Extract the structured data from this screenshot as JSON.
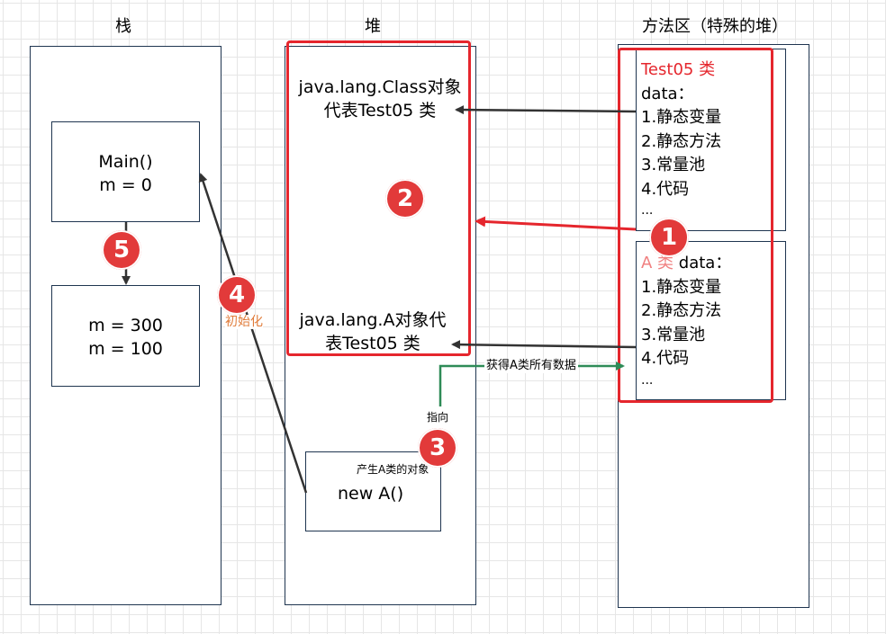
{
  "titles": {
    "stack": "栈",
    "heap": "堆",
    "method_area": "方法区（特殊的堆）"
  },
  "stack": {
    "main_frame": {
      "line1": "Main()",
      "line2": "m = 0"
    },
    "frame2": {
      "line1": "m = 300",
      "line2": "m = 100"
    }
  },
  "heap": {
    "class_object": {
      "line1": "java.lang.Class对象",
      "line2": "代表Test05 类"
    },
    "a_object": {
      "line1": "java.lang.A对象代",
      "line2": "表Test05 类"
    },
    "new_a": {
      "caption": "产生A类的对象",
      "code": "new A()"
    }
  },
  "method_area": {
    "test05": {
      "name": "Test05 类",
      "items": [
        "data：",
        "1.静态变量",
        "2.静态方法",
        "3.常量池",
        "4.代码",
        "..."
      ]
    },
    "class_a": {
      "name": "A 类",
      "header_rest": " data：",
      "items": [
        "1.静态变量",
        "2.静态方法",
        "3.常量池",
        "4.代码",
        "..."
      ]
    }
  },
  "labels": {
    "init": "初始化",
    "pointer": "指向",
    "get_data": "获得A类所有数据"
  },
  "badges": [
    "1",
    "2",
    "3",
    "4",
    "5"
  ],
  "colors": {
    "red": "#e5262d",
    "badge": "#e23a3a",
    "green": "#2e8b57",
    "dark_arrow": "#333333",
    "pink_text": "#f08080",
    "orange_text": "#e07b39"
  }
}
